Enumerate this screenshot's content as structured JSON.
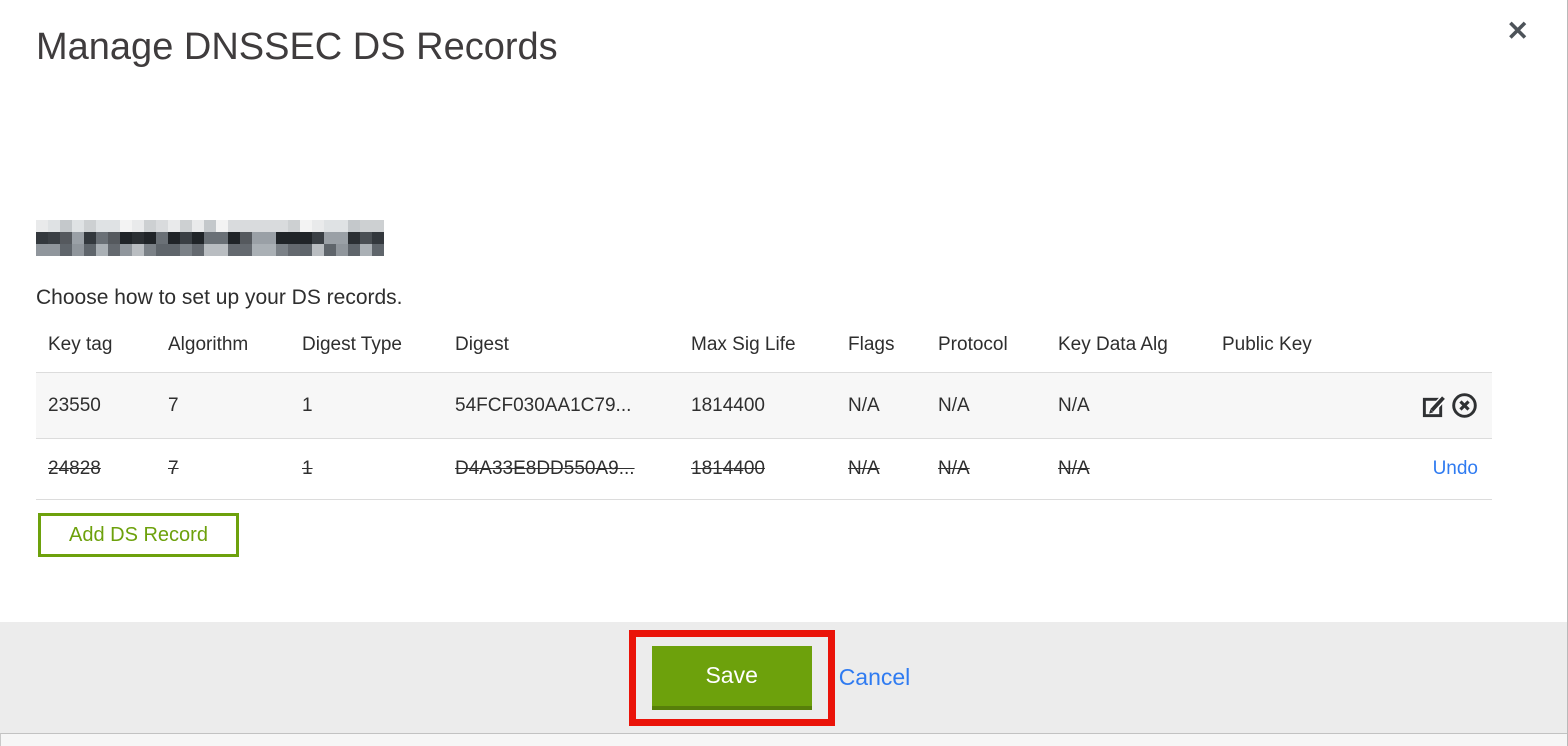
{
  "dialog": {
    "title": "Manage DNSSEC DS Records",
    "close": "✕",
    "instruction": "Choose how to set up your DS records."
  },
  "table": {
    "columns": [
      "Key tag",
      "Algorithm",
      "Digest Type",
      "Digest",
      "Max Sig Life",
      "Flags",
      "Protocol",
      "Key Data Alg",
      "Public Key"
    ],
    "rows": [
      {
        "key_tag": "23550",
        "algorithm": "7",
        "digest_type": "1",
        "digest": "54FCF030AA1C79...",
        "max_sig_life": "1814400",
        "flags": "N/A",
        "protocol": "N/A",
        "key_data_alg": "N/A",
        "public_key": "",
        "state": "active"
      },
      {
        "key_tag": "24828",
        "algorithm": "7",
        "digest_type": "1",
        "digest": "D4A33E8DD550A9...",
        "max_sig_life": "1814400",
        "flags": "N/A",
        "protocol": "N/A",
        "key_data_alg": "N/A",
        "public_key": "",
        "state": "marked-for-deletion",
        "undo_label": "Undo"
      }
    ]
  },
  "actions": {
    "add_ds_record": "Add DS Record",
    "save": "Save",
    "cancel": "Cancel"
  },
  "colors": {
    "green": "#6da10c",
    "green_dark": "#577f0a",
    "link_blue": "#2f7bf1",
    "annotation_red": "#ea1309"
  }
}
